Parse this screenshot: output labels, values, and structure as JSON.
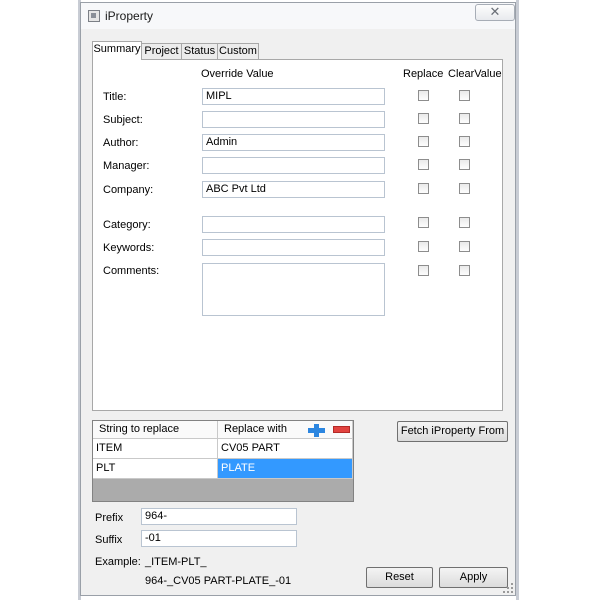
{
  "window": {
    "title": "iProperty",
    "close_glyph": "✕"
  },
  "tabs": [
    {
      "label": "Summary",
      "active": true
    },
    {
      "label": "Project",
      "active": false
    },
    {
      "label": "Status",
      "active": false
    },
    {
      "label": "Custom",
      "active": false
    }
  ],
  "summary": {
    "headers": {
      "override": "Override Value",
      "replace": "Replace",
      "clear": "ClearValue"
    },
    "rows": [
      {
        "label": "Title:",
        "value": "MIPL",
        "replace": false,
        "clear": false
      },
      {
        "label": "Subject:",
        "value": "",
        "replace": false,
        "clear": false
      },
      {
        "label": "Author:",
        "value": "Admin",
        "replace": false,
        "clear": false
      },
      {
        "label": "Manager:",
        "value": "",
        "replace": false,
        "clear": false
      },
      {
        "label": "Company:",
        "value": "ABC Pvt Ltd",
        "replace": false,
        "clear": false
      },
      {
        "label": "Category:",
        "value": "",
        "replace": false,
        "clear": false
      },
      {
        "label": "Keywords:",
        "value": "",
        "replace": false,
        "clear": false
      },
      {
        "label": "Comments:",
        "value": "",
        "replace": false,
        "clear": false
      }
    ]
  },
  "replace_grid": {
    "columns": [
      "String to replace",
      "Replace with"
    ],
    "rows": [
      {
        "find": "ITEM",
        "replace": "CV05 PART"
      },
      {
        "find": "PLT",
        "replace": "PLATE"
      }
    ],
    "selected_row": 1
  },
  "buttons": {
    "fetch": "Fetch iProperty From",
    "reset": "Reset",
    "apply": "Apply"
  },
  "naming": {
    "prefix_label": "Prefix",
    "prefix_value": "964-",
    "suffix_label": "Suffix",
    "suffix_value": "-01",
    "example_label": "Example:",
    "example_input": "_ITEM-PLT_",
    "example_output": "964-_CV05 PART-PLATE_-01"
  },
  "icons": {
    "app": "app-icon",
    "close": "close-icon",
    "add": "plus-icon",
    "remove": "minus-icon"
  },
  "colors": {
    "selection": "#3399ff",
    "add": "#2c86e0",
    "remove": "#e2433f"
  }
}
